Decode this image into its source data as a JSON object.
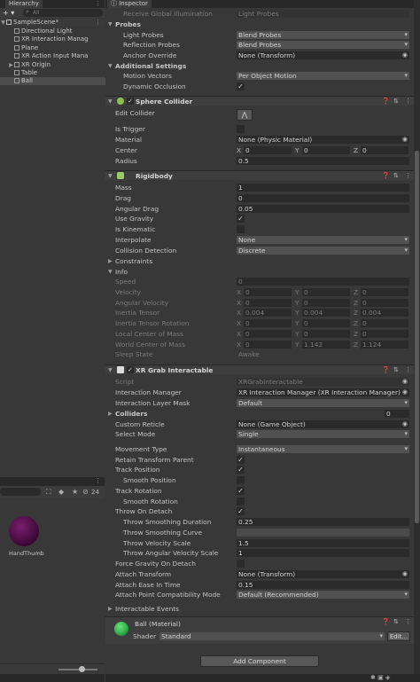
{
  "hierarchy": {
    "tab": "Hierarchy",
    "add_label": "+ ▾",
    "search_placeholder": "All",
    "scene": "SampleScene*",
    "items": [
      "Directional Light",
      "XR Interaction Manag",
      "Plane",
      "XR Action Input Mana",
      "XR Origin",
      "Table",
      "Ball"
    ],
    "selected": "Ball"
  },
  "project": {
    "hidden_count": "24",
    "asset_name": "HandThumb",
    "asset_color": "#5a1250"
  },
  "inspector": {
    "tab": "Inspector",
    "top": {
      "label": "Receive Global Illumination",
      "value": "Light Probes"
    },
    "probes": {
      "title": "Probes",
      "light_probes_label": "Light Probes",
      "light_probes": "Blend Probes",
      "reflection_label": "Reflection Probes",
      "reflection": "Blend Probes",
      "anchor_label": "Anchor Override",
      "anchor": "None (Transform)"
    },
    "additional": {
      "title": "Additional Settings",
      "motion_label": "Motion Vectors",
      "motion": "Per Object Motion",
      "dynamic_label": "Dynamic Occlusion"
    },
    "sphere": {
      "title": "Sphere Collider",
      "edit_label": "Edit Collider",
      "trigger_label": "Is Trigger",
      "material_label": "Material",
      "material": "None (Physic Material)",
      "center_label": "Center",
      "center": [
        "0",
        "0",
        "0"
      ],
      "radius_label": "Radius",
      "radius": "0.5"
    },
    "rigidbody": {
      "title": "Rigidbody",
      "mass_label": "Mass",
      "mass": "1",
      "drag_label": "Drag",
      "drag": "0",
      "angdrag_label": "Angular Drag",
      "angdrag": "0.05",
      "gravity_label": "Use Gravity",
      "kinematic_label": "Is Kinematic",
      "interp_label": "Interpolate",
      "interp": "None",
      "collision_label": "Collision Detection",
      "collision": "Discrete",
      "constraints_label": "Constraints",
      "info_label": "Info",
      "speed_label": "Speed",
      "speed": "0",
      "velocity_label": "Velocity",
      "velocity": [
        "0",
        "0",
        "0"
      ],
      "angvel_label": "Angular Velocity",
      "angvel": [
        "0",
        "0",
        "0"
      ],
      "tensor_label": "Inertia Tensor",
      "tensor": [
        "0.004",
        "0.004",
        "0.004"
      ],
      "tensorrot_label": "Inertia Tensor Rotation",
      "tensorrot": [
        "0",
        "0",
        "0"
      ],
      "localcom_label": "Local Center of Mass",
      "localcom": [
        "0",
        "0",
        "0"
      ],
      "worldcom_label": "World Center of Mass",
      "worldcom": [
        "0",
        "1.142",
        "1.124"
      ],
      "sleep_label": "Sleep State",
      "sleep": "Awake"
    },
    "xrgrab": {
      "title": "XR Grab Interactable",
      "script_label": "Script",
      "script": "XRGrabInteractable",
      "manager_label": "Interaction Manager",
      "manager": "XR Interaction Manager (XR Interaction Manager)",
      "layer_label": "Interaction Layer Mask",
      "layer": "Default",
      "colliders_label": "Colliders",
      "colliders": "0",
      "reticle_label": "Custom Reticle",
      "reticle": "None (Game Object)",
      "select_label": "Select Mode",
      "select": "Single",
      "movement_label": "Movement Type",
      "movement": "Instantaneous",
      "retain_label": "Retain Transform Parent",
      "trackpos_label": "Track Position",
      "smoothpos_label": "Smooth Position",
      "trackrot_label": "Track Rotation",
      "smoothrot_label": "Smooth Rotation",
      "throw_label": "Throw On Detach",
      "throwdur_label": "Throw Smoothing Duration",
      "throwdur": "0.25",
      "throwcurve_label": "Throw Smoothing Curve",
      "throwvel_label": "Throw Velocity Scale",
      "throwvel": "1.5",
      "throwang_label": "Throw Angular Velocity Scale",
      "throwang": "1",
      "forcegrav_label": "Force Gravity On Detach",
      "attach_label": "Attach Transform",
      "attach": "None (Transform)",
      "ease_label": "Attach Ease In Time",
      "ease": "0.15",
      "compat_label": "Attach Point Compatibility Mode",
      "compat": "Default (Recommended)",
      "events_label": "Interactable Events"
    },
    "material": {
      "name": "Ball (Material)",
      "shader_label": "Shader",
      "shader": "Standard",
      "edit_label": "Edit...",
      "color": "#2fb24a"
    },
    "add_component": "Add Component"
  },
  "colors": {
    "panel": "#383838",
    "field": "#2a2a2a",
    "header": "#3e3e3e"
  }
}
